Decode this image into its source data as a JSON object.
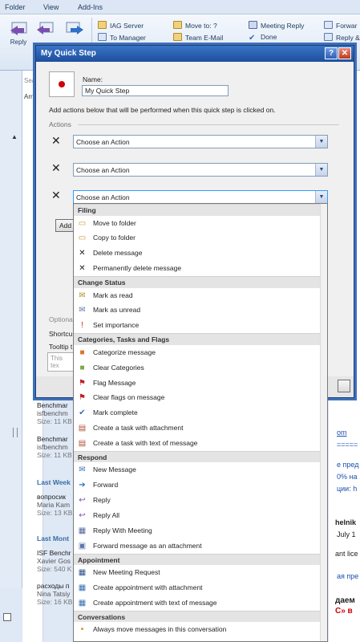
{
  "menubar": {
    "tabs": [
      "Folder",
      "View",
      "Add-Ins"
    ]
  },
  "ribbon": {
    "reply_label": "Reply",
    "quick_steps": [
      {
        "label": "IAG Server",
        "icon": "mail-folder-icon"
      },
      {
        "label": "Move to: ?",
        "icon": "move-folder-icon"
      },
      {
        "label": "Meeting Reply",
        "icon": "meeting-icon"
      },
      {
        "label": "Forwar",
        "icon": "forward-icon"
      },
      {
        "label": "To Manager",
        "icon": "mail-arrow-icon"
      },
      {
        "label": "Team E-Mail",
        "icon": "team-mail-icon"
      },
      {
        "label": "Done",
        "icon": "check-icon"
      },
      {
        "label": "Reply &",
        "icon": "reply-delete-icon"
      }
    ]
  },
  "background": {
    "search_fragment": "Sea",
    "arrange_fragment": "Arra",
    "mail_items": [
      {
        "sender": "Benchmar",
        "from": "isfbenchm",
        "meta": "Size: 11 KB"
      },
      {
        "sender": "Benchmar",
        "from": "isfbenchm",
        "meta": "Size: 11 KB"
      }
    ],
    "group_last_week": "Last Week",
    "mail_item_3": {
      "sender": "вопросик",
      "from": "Maria Kam",
      "meta": "Size: 13 KB"
    },
    "group_last_month": "Last Mont",
    "mail_item_4": {
      "sender": "ISF Benchr",
      "from": "Xavier Gos",
      "meta": "Size: 540 K"
    },
    "mail_item_5": {
      "sender": "расходы п",
      "from": "Nina Tatsiy",
      "meta": "Size: 16 KB"
    },
    "right_fragments": [
      "om",
      "=====",
      "е пред",
      "0% на",
      "ции: h",
      "helnik",
      "July 1",
      "ant lice",
      "ая пре",
      "даем",
      "С» в"
    ]
  },
  "dialog": {
    "title": "My Quick Step",
    "help": "?",
    "close": "✕",
    "name_label": "Name:",
    "name_value": "My Quick Step",
    "description": "Add actions below that will be performed when this quick step is clicked on.",
    "actions_label": "Actions",
    "action_placeholder": "Choose an Action",
    "add_action_fragment": "Add",
    "optional_fragment": "Optiona",
    "shortcut_fragment": "Shortcu",
    "tooltip_fragment": "Tooltip t",
    "tooltip_placeholder": "This tex"
  },
  "dropdown": {
    "sections": [
      {
        "header": "Filing",
        "items": [
          {
            "label": "Move to folder",
            "icon": "folder-move-icon"
          },
          {
            "label": "Copy to folder",
            "icon": "folder-copy-icon"
          },
          {
            "label": "Delete message",
            "icon": "delete-icon"
          },
          {
            "label": "Permanently delete message",
            "icon": "permanent-delete-icon"
          }
        ]
      },
      {
        "header": "Change Status",
        "items": [
          {
            "label": "Mark as read",
            "icon": "open-envelope-icon"
          },
          {
            "label": "Mark as unread",
            "icon": "closed-envelope-icon"
          },
          {
            "label": "Set importance",
            "icon": "importance-icon"
          }
        ]
      },
      {
        "header": "Categories, Tasks and Flags",
        "items": [
          {
            "label": "Categorize message",
            "icon": "categorize-icon"
          },
          {
            "label": "Clear Categories",
            "icon": "clear-categories-icon"
          },
          {
            "label": "Flag Message",
            "icon": "flag-icon"
          },
          {
            "label": "Clear flags on message",
            "icon": "clear-flag-icon"
          },
          {
            "label": "Mark complete",
            "icon": "checkmark-icon"
          },
          {
            "label": "Create a task with attachment",
            "icon": "task-attachment-icon"
          },
          {
            "label": "Create a task with text of message",
            "icon": "task-text-icon"
          }
        ]
      },
      {
        "header": "Respond",
        "items": [
          {
            "label": "New Message",
            "icon": "new-message-icon"
          },
          {
            "label": "Forward",
            "icon": "forward-icon"
          },
          {
            "label": "Reply",
            "icon": "reply-icon"
          },
          {
            "label": "Reply All",
            "icon": "reply-all-icon"
          },
          {
            "label": "Reply With Meeting",
            "icon": "reply-meeting-icon"
          },
          {
            "label": "Forward message as an attachment",
            "icon": "forward-attachment-icon"
          }
        ]
      },
      {
        "header": "Appointment",
        "items": [
          {
            "label": "New Meeting Request",
            "icon": "meeting-request-icon"
          },
          {
            "label": "Create appointment with attachment",
            "icon": "appointment-attachment-icon"
          },
          {
            "label": "Create appointment with text of message",
            "icon": "appointment-text-icon"
          }
        ]
      },
      {
        "header": "Conversations",
        "items": [
          {
            "label": "Always move messages in this conversation",
            "icon": "conversation-icon"
          }
        ]
      }
    ]
  }
}
